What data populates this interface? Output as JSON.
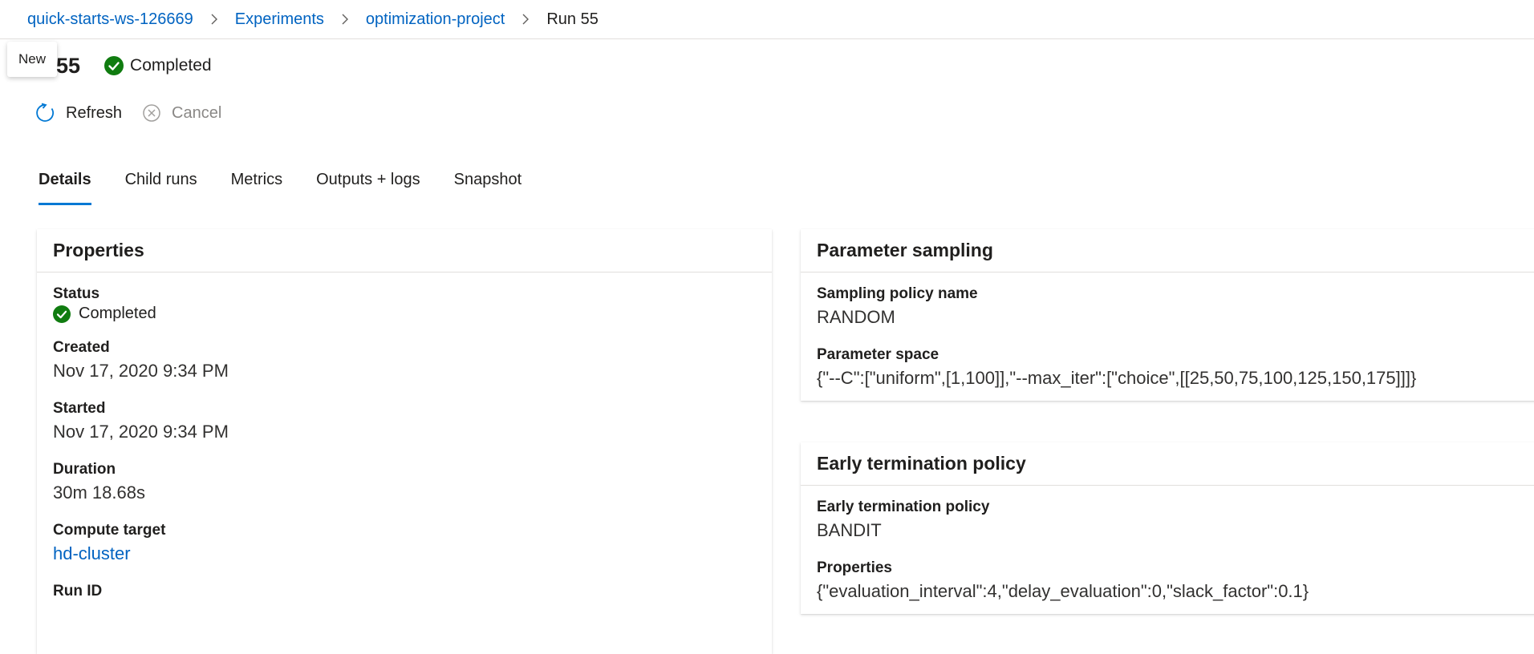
{
  "breadcrumb": {
    "items": [
      "quick-starts-ws-126669",
      "Experiments",
      "optimization-project",
      "Run 55"
    ]
  },
  "tooltip": {
    "text": "New"
  },
  "header": {
    "title": "Run 55",
    "title_visible": "n 55",
    "status": "Completed"
  },
  "toolbar": {
    "refresh_label": "Refresh",
    "cancel_label": "Cancel"
  },
  "tabs": [
    {
      "label": "Details",
      "active": true
    },
    {
      "label": "Child runs"
    },
    {
      "label": "Metrics"
    },
    {
      "label": "Outputs + logs"
    },
    {
      "label": "Snapshot"
    }
  ],
  "properties": {
    "title": "Properties",
    "status_label": "Status",
    "status_value": "Completed",
    "created_label": "Created",
    "created_value": "Nov 17, 2020 9:34 PM",
    "started_label": "Started",
    "started_value": "Nov 17, 2020 9:34 PM",
    "duration_label": "Duration",
    "duration_value": "30m 18.68s",
    "compute_label": "Compute target",
    "compute_value": "hd-cluster",
    "runid_label": "Run ID"
  },
  "parameter_sampling": {
    "title": "Parameter sampling",
    "policy_label": "Sampling policy name",
    "policy_value": "RANDOM",
    "space_label": "Parameter space",
    "space_value": "{\"--C\":[\"uniform\",[1,100]],\"--max_iter\":[\"choice\",[[25,50,75,100,125,150,175]]]}"
  },
  "early_termination": {
    "title": "Early termination policy",
    "policy_label": "Early termination policy",
    "policy_value": "BANDIT",
    "props_label": "Properties",
    "props_value": "{\"evaluation_interval\":4,\"delay_evaluation\":0,\"slack_factor\":0.1}"
  },
  "colors": {
    "link": "#0063c1",
    "success": "#107c10",
    "accent": "#0078d4",
    "disabled": "#8a8886"
  },
  "icons": [
    "chevron-right-icon",
    "check-circle-icon",
    "refresh-icon",
    "cancel-icon"
  ]
}
